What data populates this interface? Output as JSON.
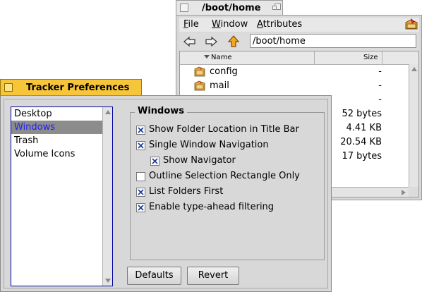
{
  "tracker_window": {
    "title": "/boot/home",
    "menu": [
      "File",
      "Window",
      "Attributes"
    ],
    "menu_mnemonics": [
      "F",
      "W",
      "A"
    ],
    "path": "/boot/home",
    "columns": {
      "name": "Name",
      "size": "Size"
    },
    "rows": [
      {
        "name": "config",
        "size": "-",
        "icon": "folder-icon"
      },
      {
        "name": "mail",
        "size": "-",
        "icon": "folder-icon"
      },
      {
        "name": "",
        "size": "-",
        "icon": ""
      },
      {
        "name": "",
        "size": "52 bytes",
        "icon": ""
      },
      {
        "name": "",
        "size": "4.41 KB",
        "icon": ""
      },
      {
        "name": "",
        "size": "20.54 KB",
        "icon": ""
      },
      {
        "name": "",
        "size": "17 bytes",
        "icon": ""
      }
    ]
  },
  "prefs_window": {
    "title": "Tracker Preferences",
    "categories": [
      "Desktop",
      "Windows",
      "Trash",
      "Volume Icons"
    ],
    "selected_category": "Windows",
    "group_title": "Windows",
    "options": [
      {
        "label": "Show Folder Location in Title Bar",
        "checked": true
      },
      {
        "label": "Single Window Navigation",
        "checked": true
      },
      {
        "label": "Show Navigator",
        "checked": true,
        "indent": true
      },
      {
        "label": "Outline Selection Rectangle Only",
        "checked": false
      },
      {
        "label": "List Folders First",
        "checked": true
      },
      {
        "label": "Enable type-ahead filtering",
        "checked": true
      }
    ],
    "buttons": {
      "defaults": "Defaults",
      "revert": "Revert"
    }
  },
  "colors": {
    "active_tab": "#f7c53a",
    "selection_bg": "#8c8c8c",
    "selection_text": "#2020ff",
    "list_border": "#0000a0",
    "check_color": "#1a3a9a"
  }
}
